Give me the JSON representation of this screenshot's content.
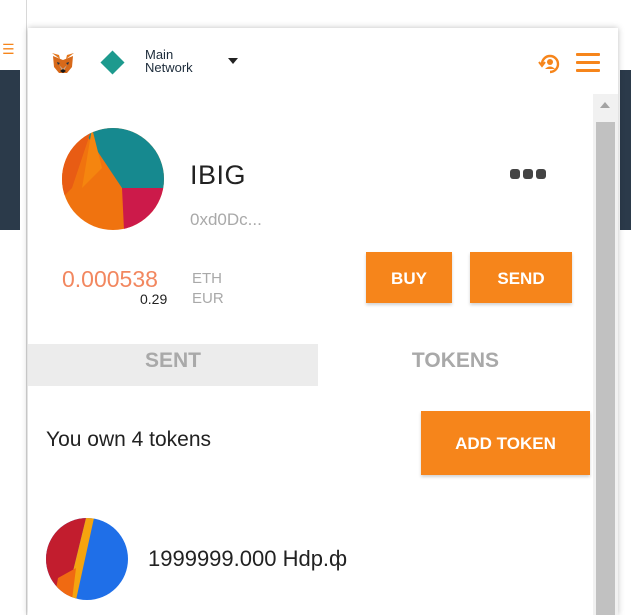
{
  "header": {
    "network_name": "Main\nNetwork"
  },
  "account": {
    "name": "IBIG",
    "address": "0xd0Dc...",
    "balance_eth": "0.000538",
    "eth_unit": "ETH",
    "balance_fiat": "0.29",
    "fiat_unit": "EUR"
  },
  "actions": {
    "buy_label": "BUY",
    "send_label": "SEND"
  },
  "tabs": [
    {
      "label": "SENT",
      "active": false
    },
    {
      "label": "TOKENS",
      "active": true
    }
  ],
  "tokens_section": {
    "own_label": "You own 4 tokens",
    "add_token_label": "ADD TOKEN",
    "items": [
      {
        "amount": "1999999.000 Hdp.ф",
        "icon": "token-identicon"
      }
    ]
  },
  "icons": {
    "fox": "metamask-fox-icon",
    "network": "network-diamond-icon",
    "caret": "caret-down-icon",
    "account": "account-switch-icon",
    "menu": "hamburger-menu-icon",
    "more": "more-dots-icon"
  },
  "colors": {
    "accent": "#f6851b",
    "network": "#1d9a8e",
    "balance": "#f2875f"
  }
}
